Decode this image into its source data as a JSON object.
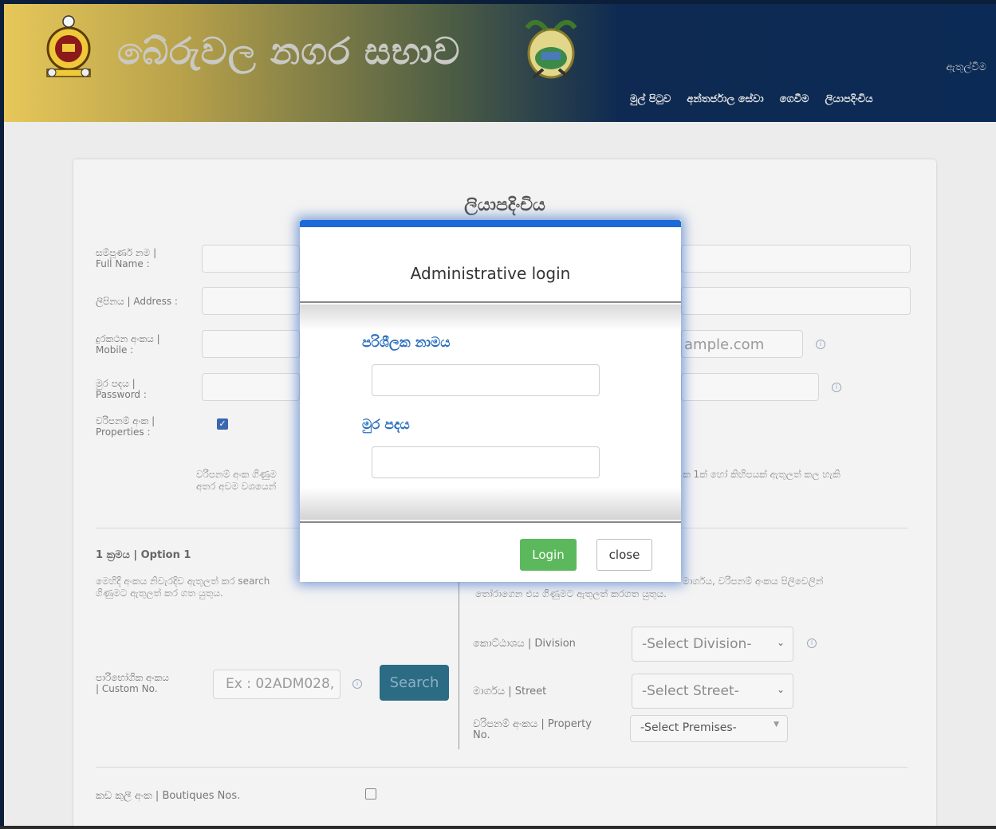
{
  "header": {
    "site_title": "බේරුවල නගර සභාව",
    "login_link": "ඇතුල්වීම",
    "nav": [
      "මුල් පිටුව",
      "අන්තර්ජාල සේවා",
      "ගෙවීම",
      "ලියාපදිංචිය"
    ]
  },
  "form": {
    "title": "ලියාපදිංචිය",
    "full_name_label": "සම්පූර්ණ නම |",
    "full_name_label_en": "Full Name :",
    "address_label": "ලිපිනය | Address :",
    "mobile_label": "දුරකථන අංකය |",
    "mobile_label_en": "Mobile :",
    "email_partial": "ample.com",
    "password_label": "මුර පදය |",
    "password_label_en": "Password :",
    "properties_label": "වරිපනම් අංක |",
    "properties_label_en": "Properties :",
    "note_left_1": "වරිපනම් අංක ගිණුම",
    "note_left_2": "අතර අවම වශයෙන්",
    "note_right": "ක 1ක් හෝ කිහිපයක් ඇතුලත් කල හැකි",
    "option1_title": "1 ක්‍රමය | Option 1",
    "option1_desc_1": "මෙහිදී අංකය නිවැරදිව ඇතුලත් කර search",
    "option1_desc_2": "ගිණුමට ඇතුලත් කර ගත යුතුය.",
    "option2_desc_1": "මාර්ගය, වරිපනම් අංකය පිලිවෙලින්",
    "option2_desc_2": "තෝරාගෙන එය ගිණුමට ඇතුලත් කරගත යුතුය.",
    "custom_no_label": "පාරිභෝගික අංකය",
    "custom_no_label_en": "| Custom No.",
    "custom_no_placeholder": "Ex : 02ADM028,",
    "search_button": "Search",
    "division_label": "කොට්ඨාශය | Division",
    "division_select": "-Select Division-",
    "street_label": "මාර්ගය | Street",
    "street_select": "-Select Street-",
    "property_label": "වරිපනම් අංකය | Property",
    "property_label_2": "No.",
    "premises_select": "-Select Premises-",
    "boutiques_label": "කඩ කුලී අංක | Boutiques Nos."
  },
  "modal": {
    "title": "Administrative login",
    "username_label": "පරිශීලක නාමය",
    "password_label": "මුර පදය",
    "login_button": "Login",
    "close_button": "close"
  },
  "colors": {
    "accent": "#1e6ad6",
    "login_green": "#5cb85c",
    "label_blue": "#2a6fbf"
  }
}
